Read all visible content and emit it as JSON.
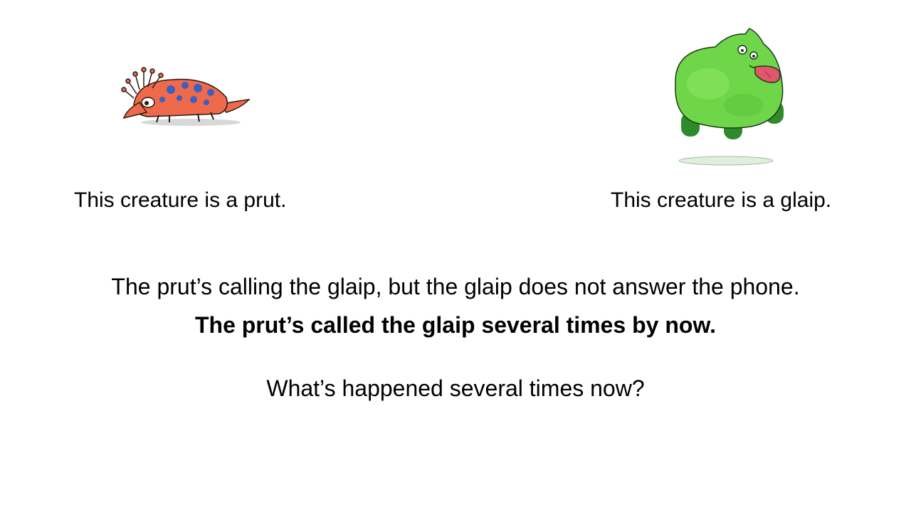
{
  "slide": {
    "creatures": {
      "prut": {
        "icon": "prut-creature-icon",
        "colors": {
          "body": "#ef6a4a",
          "spots": "#3b5fc4",
          "outline": "#2a1a14"
        }
      },
      "glaip": {
        "icon": "glaip-creature-icon",
        "colors": {
          "body": "#6fd64a",
          "dark": "#2e8a2a",
          "tongue": "#e0566a"
        }
      }
    },
    "captions": {
      "left": "This creature is a prut.",
      "right": "This creature is a glaip."
    },
    "sentences": {
      "context": "The prut’s calling the glaip, but the glaip does not answer the phone.",
      "target": "The prut’s called the glaip several times by now.",
      "question": "What’s happened several times now?"
    }
  }
}
